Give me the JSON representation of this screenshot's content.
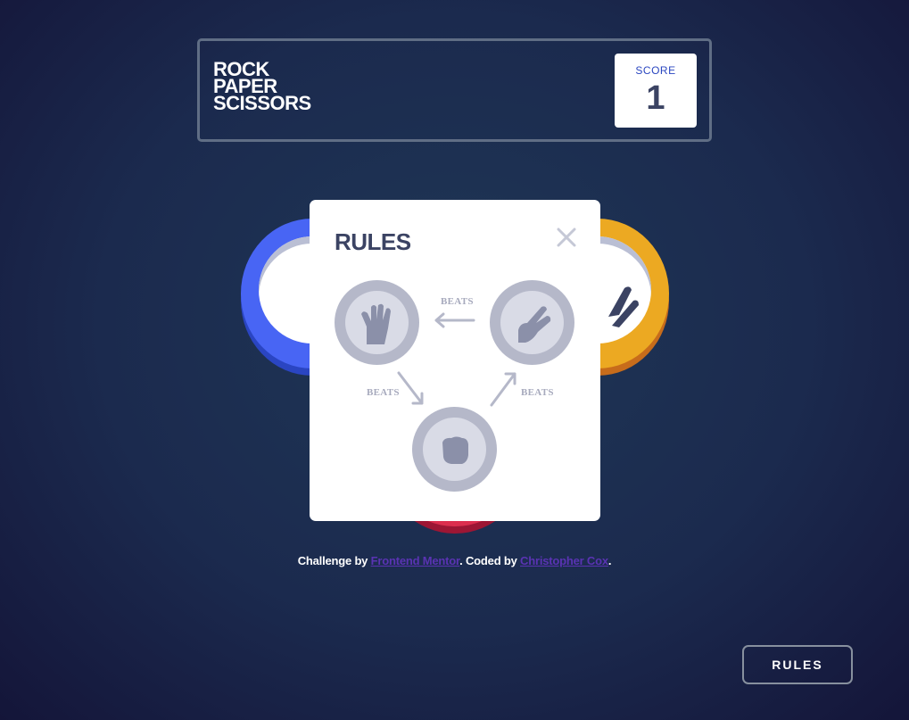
{
  "header": {
    "logo_lines": [
      "ROCK",
      "PAPER",
      "SCISSORS"
    ],
    "score_label": "SCORE",
    "score_value": "1"
  },
  "board": {
    "tokens": [
      {
        "name": "paper",
        "icon": "hand-open-icon",
        "color": "#4865f4"
      },
      {
        "name": "scissors",
        "icon": "hand-scissors-icon",
        "color": "#eca922"
      },
      {
        "name": "rock",
        "icon": "fist-icon",
        "color": "#dc2e4e"
      }
    ]
  },
  "modal": {
    "title": "RULES",
    "close_icon": "close-icon",
    "beats_labels": [
      "BEATS",
      "BEATS",
      "BEATS"
    ],
    "diagram": [
      {
        "icon": "hand-open-icon",
        "meaning": "paper"
      },
      {
        "icon": "hand-scissors-icon",
        "meaning": "scissors"
      },
      {
        "icon": "fist-icon",
        "meaning": "rock"
      }
    ]
  },
  "footer": {
    "prefix": "Challenge by ",
    "link1": "Frontend Mentor",
    "middle": ". Coded by ",
    "link2": "Christopher Cox",
    "suffix": "."
  },
  "rules_button": "RULES",
  "colors": {
    "background": "#1f3756",
    "score_text": "#2a46c0",
    "dark_text": "#3b4363",
    "link": "#5a33b3"
  }
}
